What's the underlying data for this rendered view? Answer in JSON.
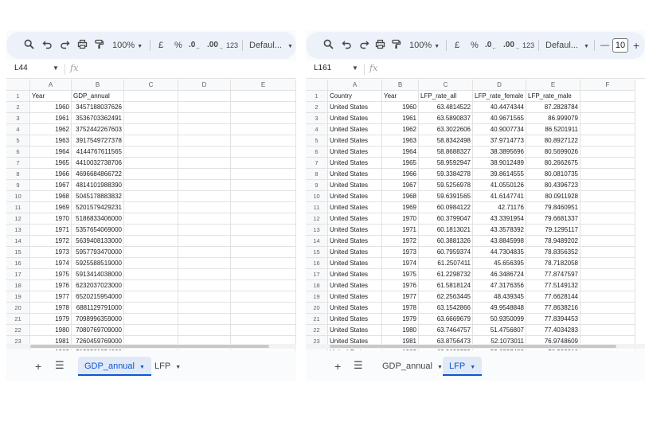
{
  "icons": {
    "search": "search-icon",
    "undo": "undo-icon",
    "redo": "redo-icon",
    "print": "print-icon",
    "paint": "paint-format-icon"
  },
  "colors": {
    "accent": "#0b57d0",
    "toolbar_bg": "#edf2fa",
    "active_tab_bg": "#e1e9f7"
  },
  "left": {
    "toolbar": {
      "zoom": "100%",
      "currency": "£",
      "percent": "%",
      "decrease_decimal": ".0",
      "increase_decimal": ".00",
      "number_format": "123",
      "font": "Defaul..."
    },
    "name_box": "L44",
    "fx": "fx",
    "columns": [
      "A",
      "B",
      "C",
      "D",
      "E"
    ],
    "rows": [
      [
        "1",
        "Year",
        "GDP_annual",
        "",
        "",
        ""
      ],
      [
        "2",
        "1960",
        "3457188037626",
        "",
        "",
        ""
      ],
      [
        "3",
        "1961",
        "3536703362491",
        "",
        "",
        ""
      ],
      [
        "4",
        "1962",
        "3752442267603",
        "",
        "",
        ""
      ],
      [
        "5",
        "1963",
        "3917549727378",
        "",
        "",
        ""
      ],
      [
        "6",
        "1964",
        "4144767611565",
        "",
        "",
        ""
      ],
      [
        "7",
        "1965",
        "4410032738706",
        "",
        "",
        ""
      ],
      [
        "8",
        "1966",
        "4696684866722",
        "",
        "",
        ""
      ],
      [
        "9",
        "1967",
        "4814101988390",
        "",
        "",
        ""
      ],
      [
        "10",
        "1968",
        "5045178883832",
        "",
        "",
        ""
      ],
      [
        "11",
        "1969",
        "5201579429231",
        "",
        "",
        ""
      ],
      [
        "12",
        "1970",
        "5186833406000",
        "",
        "",
        ""
      ],
      [
        "13",
        "1971",
        "5357654069000",
        "",
        "",
        ""
      ],
      [
        "14",
        "1972",
        "5639408133000",
        "",
        "",
        ""
      ],
      [
        "15",
        "1973",
        "5957793470000",
        "",
        "",
        ""
      ],
      [
        "16",
        "1974",
        "5925588519000",
        "",
        "",
        ""
      ],
      [
        "17",
        "1975",
        "5913414038000",
        "",
        "",
        ""
      ],
      [
        "18",
        "1976",
        "6232037023000",
        "",
        "",
        ""
      ],
      [
        "19",
        "1977",
        "6520215954000",
        "",
        "",
        ""
      ],
      [
        "20",
        "1978",
        "6881129791000",
        "",
        "",
        ""
      ],
      [
        "21",
        "1979",
        "7098996359000",
        "",
        "",
        ""
      ],
      [
        "22",
        "1980",
        "7080769709000",
        "",
        "",
        ""
      ],
      [
        "23",
        "1981",
        "7260459769000",
        "",
        "",
        ""
      ],
      [
        "24",
        "1982",
        "7129561854000",
        "",
        "",
        ""
      ]
    ],
    "tabs": [
      {
        "label": "GDP_annual",
        "active": true
      },
      {
        "label": "LFP",
        "active": false
      }
    ]
  },
  "right": {
    "toolbar": {
      "zoom": "100%",
      "currency": "£",
      "percent": "%",
      "decrease_decimal": ".0",
      "increase_decimal": ".00",
      "number_format": "123",
      "font": "Defaul...",
      "font_size_minus": "—",
      "font_size": "10",
      "font_size_plus": "+"
    },
    "name_box": "L161",
    "fx": "fx",
    "columns": [
      "A",
      "B",
      "C",
      "D",
      "E",
      "F"
    ],
    "rows": [
      [
        "1",
        "Country",
        "Year",
        "LFP_rate_all",
        "LFP_rate_female",
        "LFP_rate_male",
        ""
      ],
      [
        "2",
        "United States",
        "1960",
        "63.4814522",
        "40.4474344",
        "87.2828784",
        ""
      ],
      [
        "3",
        "United States",
        "1961",
        "63.5890837",
        "40.9671565",
        "86.999079",
        ""
      ],
      [
        "4",
        "United States",
        "1962",
        "63.3022606",
        "40.9007734",
        "86.5201911",
        ""
      ],
      [
        "5",
        "United States",
        "1963",
        "58.8342498",
        "37.9714773",
        "80.8927122",
        ""
      ],
      [
        "6",
        "United States",
        "1964",
        "58.8688327",
        "38.3895696",
        "80.5699026",
        ""
      ],
      [
        "7",
        "United States",
        "1965",
        "58.9592947",
        "38.9012489",
        "80.2662675",
        ""
      ],
      [
        "8",
        "United States",
        "1966",
        "59.3384278",
        "39.8614555",
        "80.0810735",
        ""
      ],
      [
        "9",
        "United States",
        "1967",
        "59.5256978",
        "41.0550126",
        "80.4396723",
        ""
      ],
      [
        "10",
        "United States",
        "1968",
        "59.6391565",
        "41.6147741",
        "80.0911928",
        ""
      ],
      [
        "11",
        "United States",
        "1969",
        "60.0984122",
        "42.71176",
        "79.8460951",
        ""
      ],
      [
        "12",
        "United States",
        "1970",
        "60.3799047",
        "43.3391954",
        "79.6681337",
        ""
      ],
      [
        "13",
        "United States",
        "1971",
        "60.1813021",
        "43.3578392",
        "79.1295117",
        ""
      ],
      [
        "14",
        "United States",
        "1972",
        "60.3881326",
        "43.8845998",
        "78.9489202",
        ""
      ],
      [
        "15",
        "United States",
        "1973",
        "60.7959374",
        "44.7304835",
        "78.8356352",
        ""
      ],
      [
        "16",
        "United States",
        "1974",
        "61.2507411",
        "45.656395",
        "78.7182058",
        ""
      ],
      [
        "17",
        "United States",
        "1975",
        "61.2298732",
        "46.3486724",
        "77.8747597",
        ""
      ],
      [
        "18",
        "United States",
        "1976",
        "61.5818124",
        "47.3176356",
        "77.5149132",
        ""
      ],
      [
        "19",
        "United States",
        "1977",
        "62.2563445",
        "48.439345",
        "77.6628144",
        ""
      ],
      [
        "20",
        "United States",
        "1978",
        "63.1542866",
        "49.9548848",
        "77.8638216",
        ""
      ],
      [
        "21",
        "United States",
        "1979",
        "63.6669679",
        "50.9350099",
        "77.8394453",
        ""
      ],
      [
        "22",
        "United States",
        "1980",
        "63.7464757",
        "51.4756807",
        "77.4034283",
        ""
      ],
      [
        "23",
        "United States",
        "1981",
        "63.8756473",
        "52.1073011",
        "76.9748609",
        ""
      ],
      [
        "24",
        "United States",
        "1982",
        "63.9699729",
        "52.6237493",
        "76.599816",
        ""
      ]
    ],
    "tabs": [
      {
        "label": "GDP_annual",
        "active": false
      },
      {
        "label": "LFP",
        "active": true
      }
    ]
  }
}
